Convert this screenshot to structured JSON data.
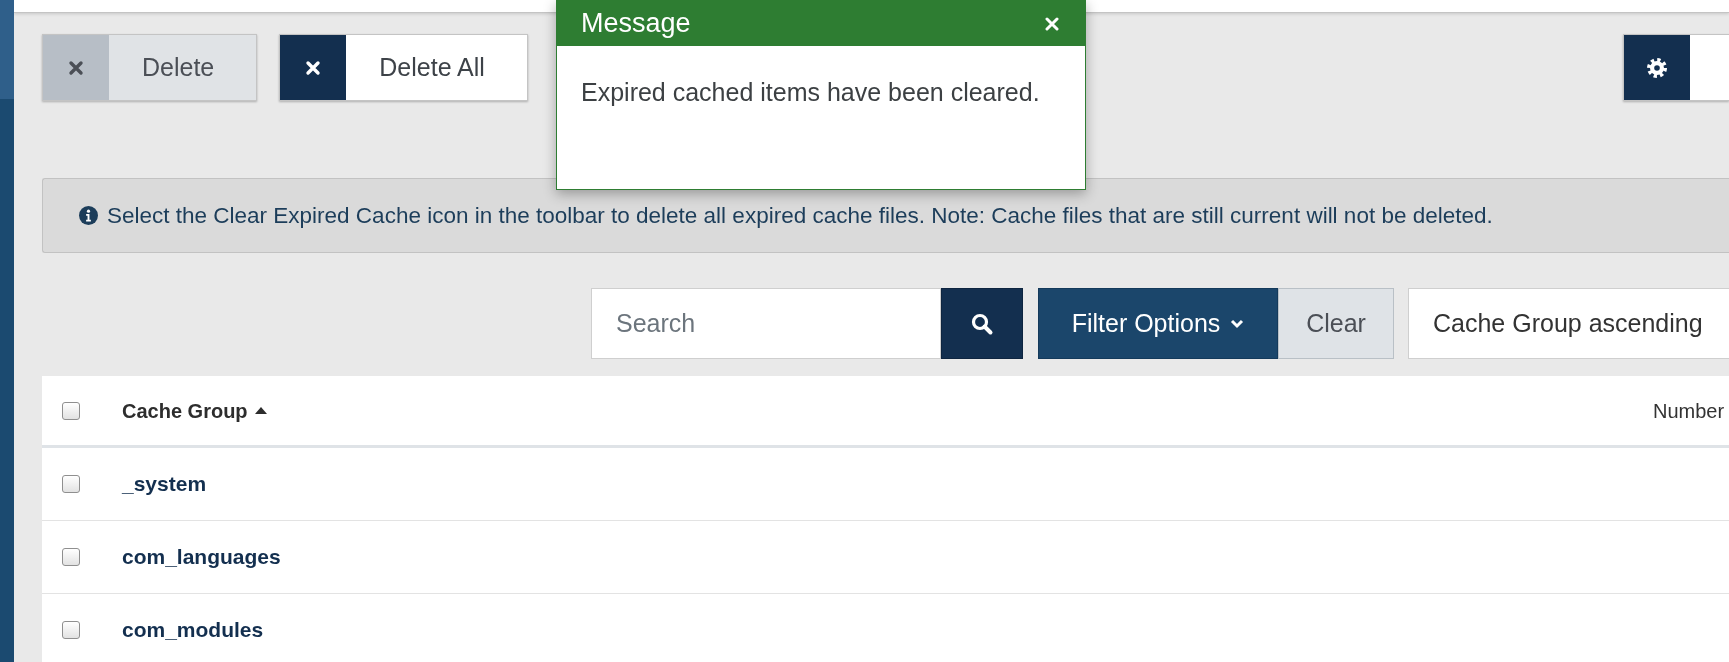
{
  "toolbar": {
    "buttons": [
      {
        "label": "Delete",
        "disabled": true
      },
      {
        "label": "Delete All",
        "disabled": false
      }
    ]
  },
  "message": {
    "title": "Message",
    "text": "Expired cached items have been cleared."
  },
  "info_alert": {
    "text": "Select the Clear Expired Cache icon in the toolbar to delete all expired cache files. Note: Cache files that are still current will not be deleted."
  },
  "search": {
    "placeholder": "Search"
  },
  "filters": {
    "filter_options": "Filter Options",
    "clear": "Clear",
    "sort": "Cache Group ascending"
  },
  "table": {
    "select_all_checked": false,
    "columns": [
      {
        "label": "Cache Group",
        "sorted": true
      },
      {
        "label": "Number",
        "sorted": false
      }
    ],
    "rows": [
      {
        "cache_group": "_system",
        "checked": false
      },
      {
        "cache_group": "com_languages",
        "checked": false
      },
      {
        "cache_group": "com_modules",
        "checked": false
      }
    ]
  }
}
